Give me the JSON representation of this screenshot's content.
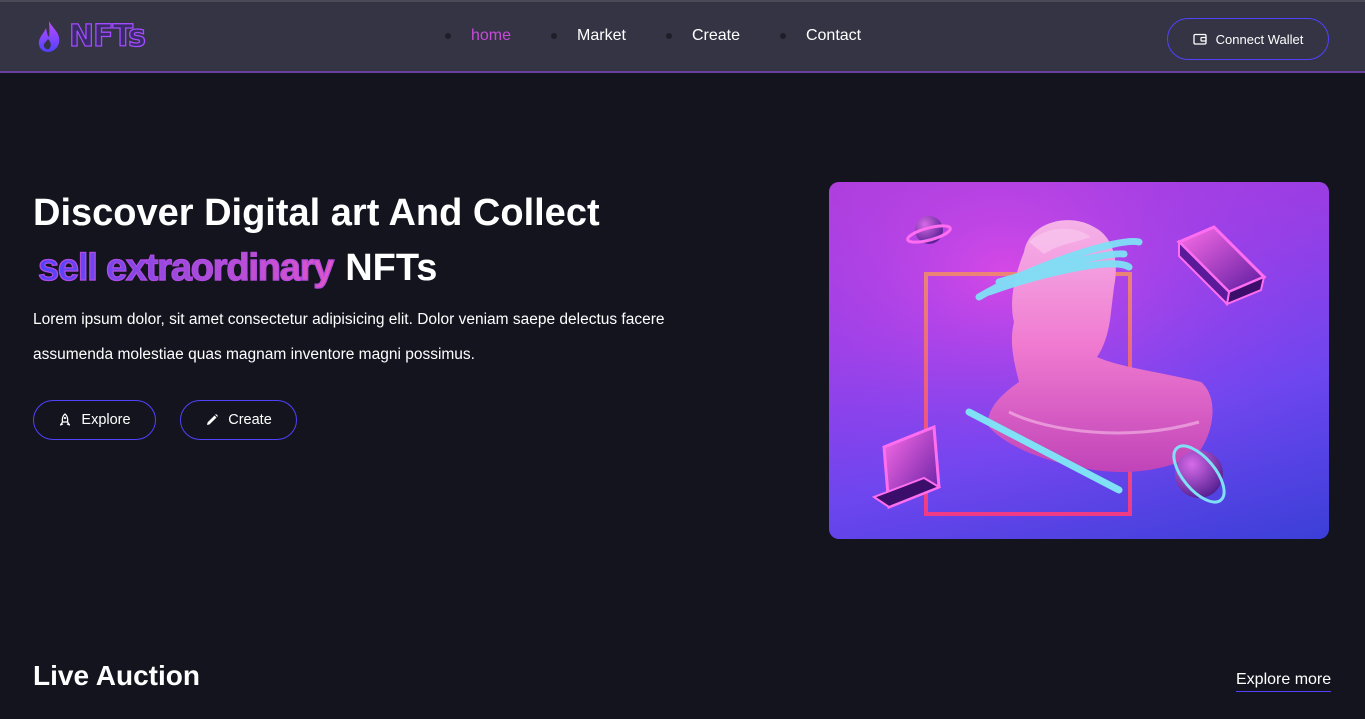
{
  "header": {
    "logo_text": "NFTs",
    "nav": [
      {
        "label": "home",
        "active": true
      },
      {
        "label": "Market",
        "active": false
      },
      {
        "label": "Create",
        "active": false
      },
      {
        "label": "Contact",
        "active": false
      }
    ],
    "connect_wallet_label": "Connect Wallet"
  },
  "hero": {
    "title_line1": "Discover Digital art And Collect",
    "title_highlight": "sell extraordinary",
    "title_end": "NFTs",
    "description": "Lorem ipsum dolor, sit amet consectetur adipisicing elit. Dolor veniam saepe delectus facere assumenda molestiae quas magnam inventore magni possimus.",
    "explore_label": "Explore",
    "create_label": "Create"
  },
  "live_auction": {
    "title": "Live Auction",
    "explore_more_label": "Explore more"
  },
  "colors": {
    "background": "#14141f",
    "header": "#343444",
    "accent": "#5142fc",
    "active_nav": "#c84ad9"
  },
  "icons": {
    "logo": "flame-icon",
    "wallet": "wallet-icon",
    "explore": "rocket-icon",
    "create": "pencil-icon"
  }
}
